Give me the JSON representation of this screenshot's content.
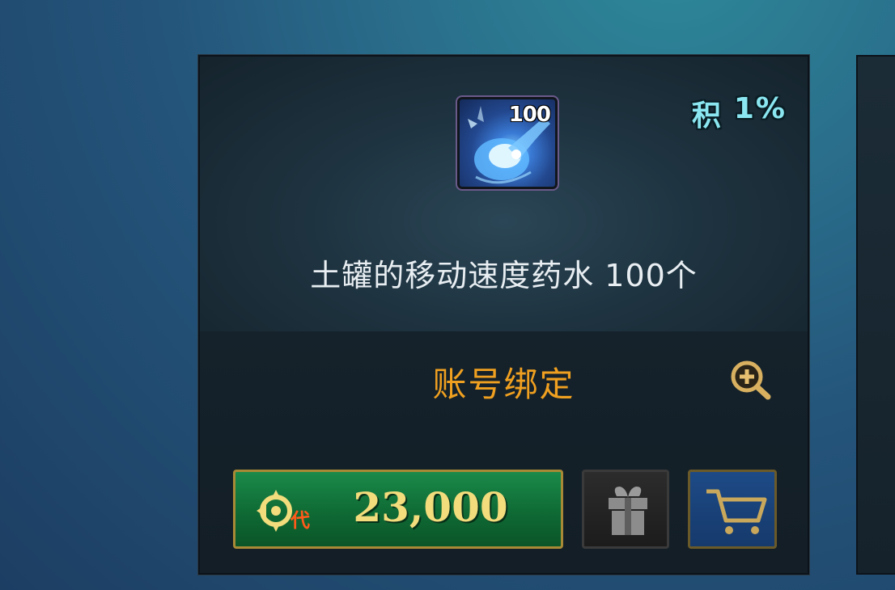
{
  "card": {
    "rate_badge": {
      "label": "积",
      "value": "1%"
    },
    "item": {
      "icon_name": "movement-speed-potion-icon",
      "quantity_overlay": "100",
      "name": "土罐的移动速度药水 100个"
    },
    "bind_type": "账号绑定",
    "zoom_icon": "zoom-in-icon",
    "buy": {
      "currency_icon": "dai-coin-icon",
      "currency_label": "代",
      "price": "23,000"
    },
    "gift_icon": "gift-icon",
    "cart_icon": "cart-icon"
  },
  "colors": {
    "bind_text": "#f0a020",
    "price_text": "#f2dc7c",
    "buy_button": "#0f6a34",
    "cart_button": "#1d4a86",
    "rate_text": "#8ae6f0"
  }
}
